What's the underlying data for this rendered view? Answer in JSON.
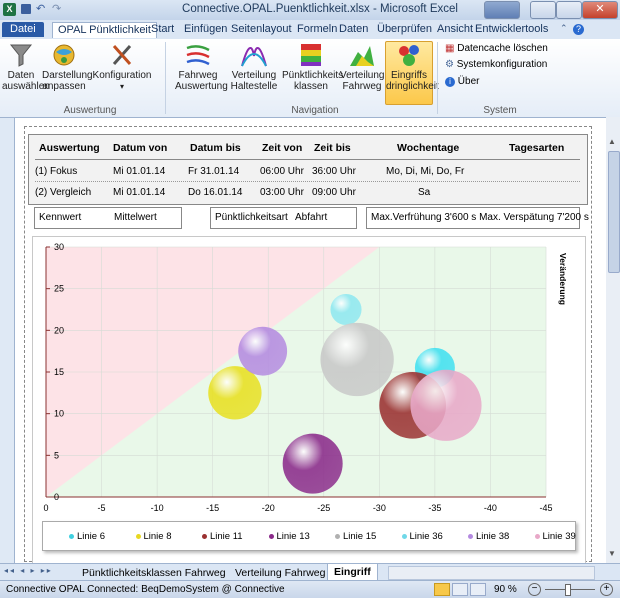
{
  "window": {
    "title": "Connective.OPAL.Puenktlichkeit.xlsx - Microsoft Excel"
  },
  "ribbon_tabs": [
    "Datei",
    "OPAL Pünktlichkeit",
    "Start",
    "Einfügen",
    "Seitenlayout",
    "Formeln",
    "Daten",
    "Überprüfen",
    "Ansicht",
    "Entwicklertools"
  ],
  "ribbon": {
    "auswertung": {
      "group": "Auswertung",
      "daten": "Daten auswählen",
      "darstellung": "Darstellung anpassen",
      "konfiguration": "Konfiguration"
    },
    "navigation": {
      "group": "Navigation",
      "fahrweg": "Fahrweg Auswertung",
      "haltestelle": "Verteilung Haltestelle",
      "klassen": "Pünktlichkeits klassen",
      "verteilung": "Verteilung Fahrweg",
      "eingriffs": "Eingriffs dringlichkeit"
    },
    "system": {
      "group": "System",
      "cache": "Datencache löschen",
      "sysconf": "Systemkonfiguration",
      "ueber": "Über"
    }
  },
  "table": {
    "headers": [
      "Auswertung",
      "Datum von",
      "Datum bis",
      "Zeit von",
      "Zeit bis",
      "Wochentage",
      "Tagesarten"
    ],
    "rows": [
      [
        "(1) Fokus",
        "Mi 01.01.14",
        "Fr 31.01.14",
        "06:00 Uhr",
        "36:00 Uhr",
        "Mo, Di, Mi, Do, Fr",
        ""
      ],
      [
        "(2) Vergleich",
        "Mi 01.01.14",
        "Do 16.01.14",
        "03:00 Uhr",
        "09:00 Uhr",
        "Sa",
        ""
      ]
    ],
    "kennwert_label": "Kennwert",
    "kennwert_value": "Mittelwert",
    "puenkt_label": "Pünktlichkeitsart",
    "puenkt_value": "Abfahrt",
    "limits": "Max.Verfrühung 3'600 s Max. Verspätung 7'200 s"
  },
  "chart_data": {
    "type": "scatter",
    "ylabel": "Veränderung",
    "xlim": [
      0,
      -45
    ],
    "ylim": [
      0,
      30
    ],
    "xticks": [
      0,
      -5,
      -10,
      -15,
      -20,
      -25,
      -30,
      -35,
      -40,
      -45
    ],
    "yticks": [
      0,
      5,
      10,
      15,
      20,
      25,
      30
    ],
    "bubbles": [
      {
        "name": "Linie 13",
        "x": -24,
        "y": 4,
        "size": 2.7,
        "color": "#8a2a8a"
      },
      {
        "name": "Linie 8",
        "x": -17,
        "y": 12.5,
        "size": 2.4,
        "color": "#e8e020"
      },
      {
        "name": "Linie 38",
        "x": -19.5,
        "y": 17.5,
        "size": 2.2,
        "color": "#b48ae0"
      },
      {
        "name": "Linie 36",
        "x": -27,
        "y": 22.5,
        "size": 1.4,
        "color": "#8ee8f0"
      },
      {
        "name": "Linie 15",
        "x": -28,
        "y": 16.5,
        "size": 3.3,
        "color": "#c8c8c8"
      },
      {
        "name": "Linie 6",
        "x": -35,
        "y": 15.5,
        "size": 1.8,
        "color": "#40e0f0"
      },
      {
        "name": "Linie 11",
        "x": -33,
        "y": 11,
        "size": 3.0,
        "color": "#9a3030"
      },
      {
        "name": "Linie 39",
        "x": -36,
        "y": 11,
        "size": 3.2,
        "color": "#e8a8c8"
      }
    ],
    "legend": [
      {
        "name": "Linie 6",
        "color": "#40d0e0"
      },
      {
        "name": "Linie 8",
        "color": "#e8d820"
      },
      {
        "name": "Linie 11",
        "color": "#9a3030"
      },
      {
        "name": "Linie 13",
        "color": "#8a2a8a"
      },
      {
        "name": "Linie 15",
        "color": "#b0b0b0"
      },
      {
        "name": "Linie 36",
        "color": "#70d8e8"
      },
      {
        "name": "Linie 38",
        "color": "#b48ae0"
      },
      {
        "name": "Linie 39",
        "color": "#e8a8c8"
      }
    ]
  },
  "sheet_tabs": [
    "Pünktlichkeitsklassen Fahrweg",
    "Verteilung Fahrweg",
    "Eingriff"
  ],
  "status": {
    "text": "Connective OPAL Connected: BeqDemoSystem @ Connective",
    "zoom": "90 %"
  }
}
